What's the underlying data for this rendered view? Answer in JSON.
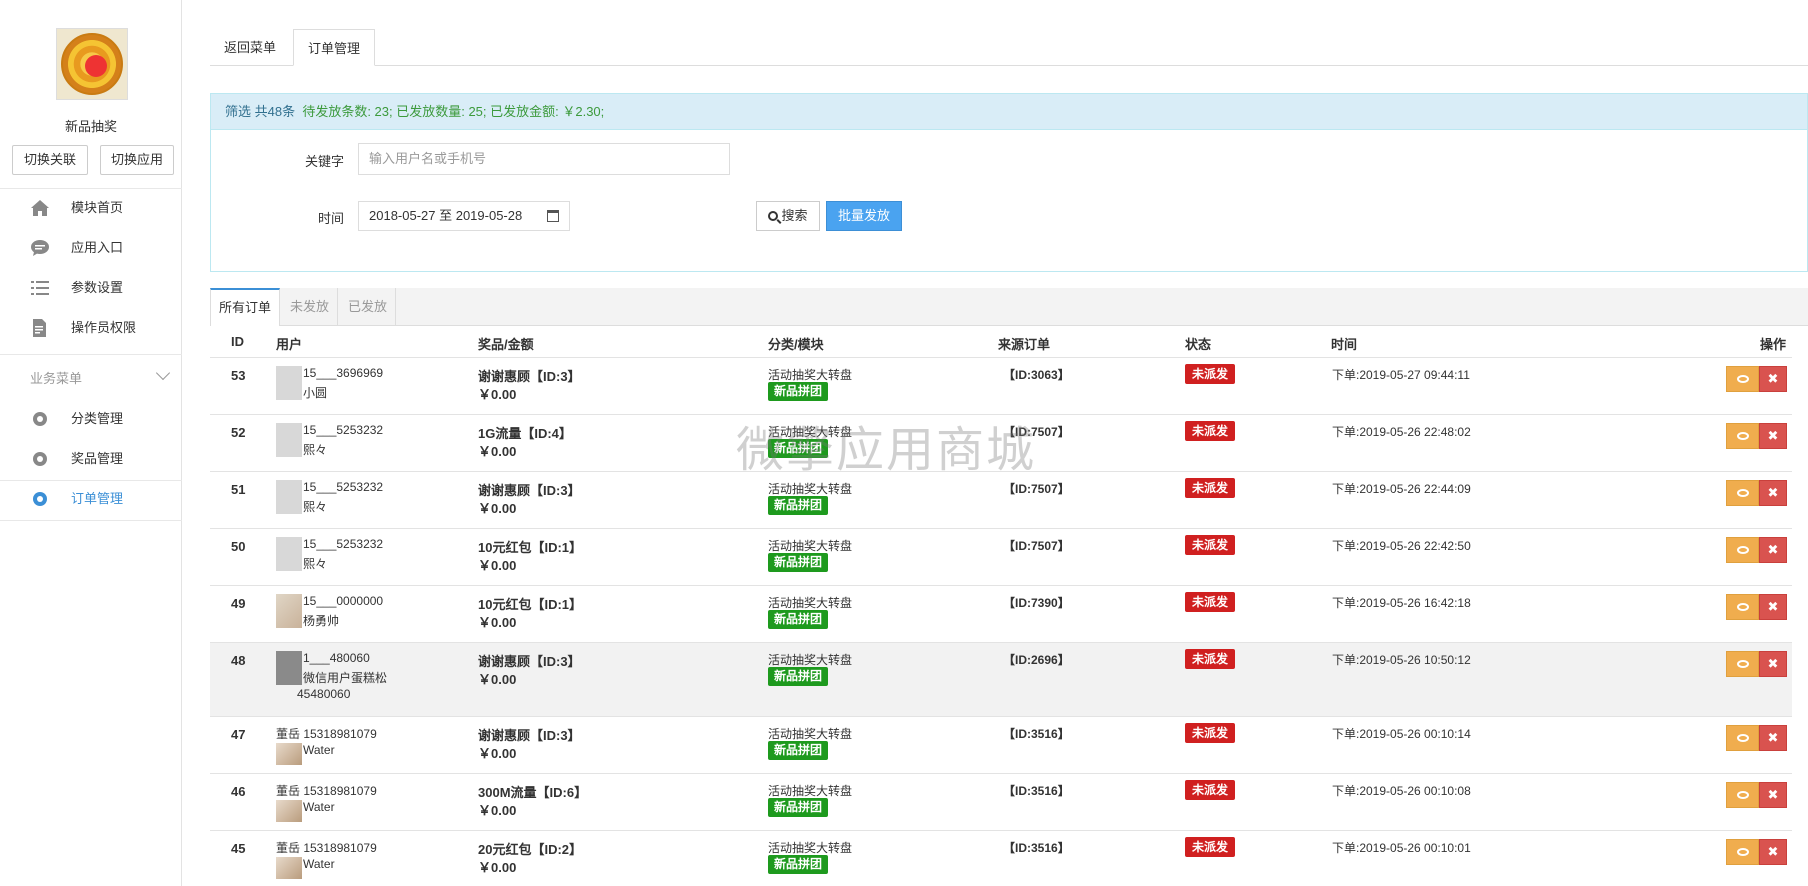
{
  "sidebar": {
    "app_name": "新品抽奖",
    "switch_link": "切换关联",
    "switch_app": "切换应用",
    "items": [
      {
        "label": "模块首页",
        "icon": "home-icon"
      },
      {
        "label": "应用入口",
        "icon": "chat-icon"
      },
      {
        "label": "参数设置",
        "icon": "list-icon"
      },
      {
        "label": "操作员权限",
        "icon": "document-icon"
      }
    ],
    "section_title": "业务菜单",
    "business_items": [
      {
        "label": "分类管理",
        "icon": "gear-icon"
      },
      {
        "label": "奖品管理",
        "icon": "gear-icon"
      },
      {
        "label": "订单管理",
        "icon": "gear-icon",
        "active": true
      }
    ]
  },
  "top_tabs": [
    "返回菜单",
    "订单管理"
  ],
  "filter": {
    "summary_a": "筛选 共48条",
    "summary_b": "待发放条数: 23; 已发放数量: 25; 已发放金额: ￥2.30;",
    "keyword_label": "关键字",
    "keyword_placeholder": "输入用户名或手机号",
    "time_label": "时间",
    "date_range": "2018-05-27 至 2019-05-28",
    "search_label": "搜索",
    "batch_label": "批量发放"
  },
  "order_tabs": [
    "所有订单",
    "未发放",
    "已发放"
  ],
  "columns": [
    "ID",
    "用户",
    "奖品/金额",
    "分类/模块",
    "来源订单",
    "状态",
    "时间",
    "操作"
  ],
  "rows": [
    {
      "id": "53",
      "phone": "15___3696969",
      "nick": "小圆",
      "prize": "谢谢惠顾【ID:3】",
      "amount": "￥0.00",
      "category": "活动抽奖大转盘",
      "module": "新品拼团",
      "source": "【ID:3063】",
      "status": "未派发",
      "time": "下单:2019-05-27 09:44:11"
    },
    {
      "id": "52",
      "phone": "15___5253232",
      "nick": "熙々",
      "prize": "1G流量【ID:4】",
      "amount": "￥0.00",
      "category": "活动抽奖大转盘",
      "module": "新品拼团",
      "source": "【ID:7507】",
      "status": "未派发",
      "time": "下单:2019-05-26 22:48:02"
    },
    {
      "id": "51",
      "phone": "15___5253232",
      "nick": "熙々",
      "prize": "谢谢惠顾【ID:3】",
      "amount": "￥0.00",
      "category": "活动抽奖大转盘",
      "module": "新品拼团",
      "source": "【ID:7507】",
      "status": "未派发",
      "time": "下单:2019-05-26 22:44:09"
    },
    {
      "id": "50",
      "phone": "15___5253232",
      "nick": "熙々",
      "prize": "10元红包【ID:1】",
      "amount": "￥0.00",
      "category": "活动抽奖大转盘",
      "module": "新品拼团",
      "source": "【ID:7507】",
      "status": "未派发",
      "time": "下单:2019-05-26 22:42:50"
    },
    {
      "id": "49",
      "phone": "15___0000000",
      "nick": "杨勇帅",
      "prize": "10元红包【ID:1】",
      "amount": "￥0.00",
      "category": "活动抽奖大转盘",
      "module": "新品拼团",
      "source": "【ID:7390】",
      "status": "未派发",
      "time": "下单:2019-05-26 16:42:18"
    },
    {
      "id": "48",
      "phone": "1___480060",
      "nick": "微信用户蛋糕松",
      "nick2": "45480060",
      "prize": "谢谢惠顾【ID:3】",
      "amount": "￥0.00",
      "category": "活动抽奖大转盘",
      "module": "新品拼团",
      "source": "【ID:2696】",
      "status": "未派发",
      "time": "下单:2019-05-26 10:50:12"
    },
    {
      "id": "47",
      "phone": "董岳 15318981079",
      "nick": "Water",
      "prize": "谢谢惠顾【ID:3】",
      "amount": "￥0.00",
      "category": "活动抽奖大转盘",
      "module": "新品拼团",
      "source": "【ID:3516】",
      "status": "未派发",
      "time": "下单:2019-05-26 00:10:14"
    },
    {
      "id": "46",
      "phone": "董岳 15318981079",
      "nick": "Water",
      "prize": "300M流量【ID:6】",
      "amount": "￥0.00",
      "category": "活动抽奖大转盘",
      "module": "新品拼团",
      "source": "【ID:3516】",
      "status": "未派发",
      "time": "下单:2019-05-26 00:10:08"
    },
    {
      "id": "45",
      "phone": "董岳 15318981079",
      "nick": "Water",
      "prize": "20元红包【ID:2】",
      "amount": "￥0.00",
      "category": "活动抽奖大转盘",
      "module": "新品拼团",
      "source": "【ID:3516】",
      "status": "未派发",
      "time": "下单:2019-05-26 00:10:01"
    }
  ],
  "watermark": "微擎应用商城",
  "colors": {
    "accent": "#3b8fd6",
    "success": "#1e9a1e",
    "danger": "#d02020",
    "warning": "#f0ad4e"
  }
}
